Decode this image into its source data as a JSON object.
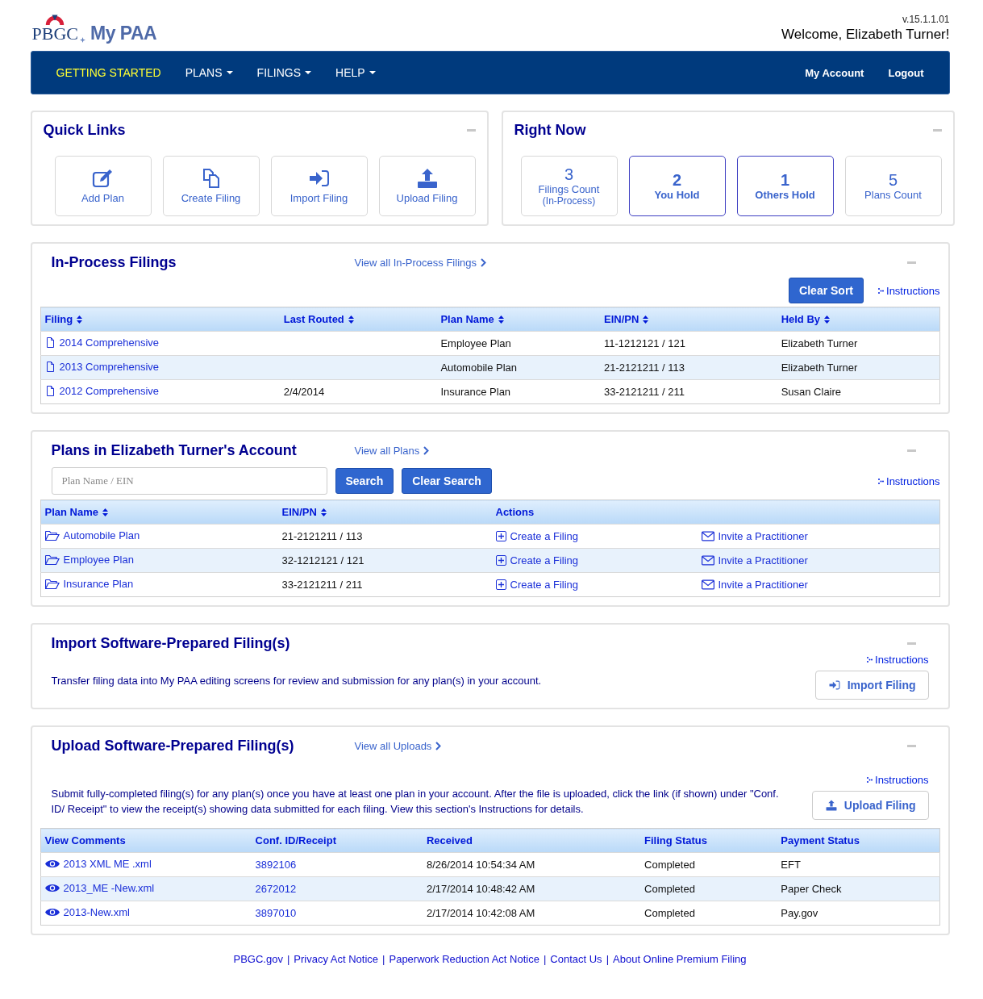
{
  "header": {
    "logo_org": "PBGC",
    "logo_app": "My PAA",
    "version": "v.15.1.1.01",
    "welcome": "Welcome, Elizabeth Turner!"
  },
  "nav": {
    "left": [
      {
        "label": "GETTING STARTED",
        "selected": true,
        "dropdown": false
      },
      {
        "label": "PLANS",
        "selected": false,
        "dropdown": true
      },
      {
        "label": "FILINGS",
        "selected": false,
        "dropdown": true
      },
      {
        "label": "HELP",
        "selected": false,
        "dropdown": true
      }
    ],
    "right": [
      {
        "label": "My Account"
      },
      {
        "label": "Logout"
      }
    ]
  },
  "quick_links": {
    "title": "Quick Links",
    "items": [
      {
        "label": "Add Plan",
        "kind": "edit"
      },
      {
        "label": "Create Filing",
        "kind": "copy"
      },
      {
        "label": "Import Filing",
        "kind": "import"
      },
      {
        "label": "Upload Filing",
        "kind": "upload"
      }
    ]
  },
  "right_now": {
    "title": "Right Now",
    "items": [
      {
        "count": "3",
        "label": "Filings Count",
        "sublabel": "(In-Process)",
        "emphasized": false
      },
      {
        "count": "2",
        "label": "You Hold",
        "emphasized": true
      },
      {
        "count": "1",
        "label": "Others Hold",
        "emphasized": true
      },
      {
        "count": "5",
        "label": "Plans Count",
        "emphasized": false
      }
    ]
  },
  "in_process": {
    "title": "In-Process Filings",
    "view_all": "View all In-Process Filings",
    "clear_sort": "Clear Sort",
    "instructions": "Instructions",
    "columns": [
      {
        "label": "Filing",
        "sortable": true
      },
      {
        "label": "Last Routed",
        "sortable": true
      },
      {
        "label": "Plan Name",
        "sortable": true
      },
      {
        "label": "EIN/PN",
        "sortable": true
      },
      {
        "label": "Held By",
        "sortable": true
      }
    ],
    "rows": [
      [
        "2014 Comprehensive",
        "",
        "Employee Plan",
        "11-1212121 / 121",
        "Elizabeth Turner"
      ],
      [
        "2013 Comprehensive",
        "",
        "Automobile Plan",
        "21-2121211 / 113",
        "Elizabeth Turner"
      ],
      [
        "2012 Comprehensive",
        "2/4/2014",
        "Insurance Plan",
        "33-2121211 / 211",
        "Susan Claire"
      ]
    ]
  },
  "plans": {
    "title": "Plans in Elizabeth Turner's Account",
    "view_all": "View all Plans",
    "search": {
      "placeholder": "Plan Name / EIN"
    },
    "search_button": "Search",
    "clear_button": "Clear Search",
    "instructions": "Instructions",
    "columns": [
      {
        "label": "Plan Name",
        "sortable": true
      },
      {
        "label": "EIN/PN",
        "sortable": true
      },
      {
        "label": "Actions",
        "sortable": false
      }
    ],
    "rows": [
      [
        "Automobile Plan",
        "21-2121211 / 113",
        [
          "Create a Filing",
          "Invite a Practitioner"
        ]
      ],
      [
        "Employee Plan",
        "32-1212121 / 121",
        [
          "Create a Filing",
          "Invite a Practitioner"
        ]
      ],
      [
        "Insurance Plan",
        "33-2121211 / 211",
        [
          "Create a Filing",
          "Invite a Practitioner"
        ]
      ]
    ]
  },
  "import": {
    "title": "Import Software-Prepared Filing(s)",
    "instructions": "Instructions",
    "description": "Transfer filing data into My PAA editing screens for review and submission for any plan(s) in your account.",
    "button": "Import Filing"
  },
  "upload": {
    "title": "Upload Software-Prepared Filing(s)",
    "view_all": "View all Uploads",
    "instructions": "Instructions",
    "description": "Submit fully-completed filing(s) for any plan(s) once you have at least one plan in your account. After the file is uploaded, click the link (if shown) under \"Conf. ID/ Receipt\" to view the receipt(s) showing data submitted for each filing. View this section's Instructions for details.",
    "button": "Upload Filing",
    "columns": [
      {
        "label": "View Comments",
        "sortable": false
      },
      {
        "label": "Conf. ID/Receipt",
        "sortable": false
      },
      {
        "label": "Received",
        "sortable": false
      },
      {
        "label": "Filing Status",
        "sortable": false
      },
      {
        "label": "Payment Status",
        "sortable": false
      }
    ],
    "rows": [
      [
        "2013 XML ME .xml",
        "3892106",
        "8/26/2014 10:54:34 AM",
        "Completed",
        "EFT"
      ],
      [
        "2013_ME -New.xml",
        "2672012",
        "2/17/2014 10:48:42 AM",
        "Completed",
        "Paper Check"
      ],
      [
        "2013-New.xml",
        "3897010",
        "2/17/2014 10:42:08 AM",
        "Completed",
        "Pay.gov"
      ]
    ]
  },
  "footer": {
    "separator": "|",
    "links": [
      "PBGC.gov",
      "Privacy Act Notice",
      "Paperwork Reduction Act Notice",
      "Contact Us",
      "About Online Premium Filing"
    ]
  }
}
